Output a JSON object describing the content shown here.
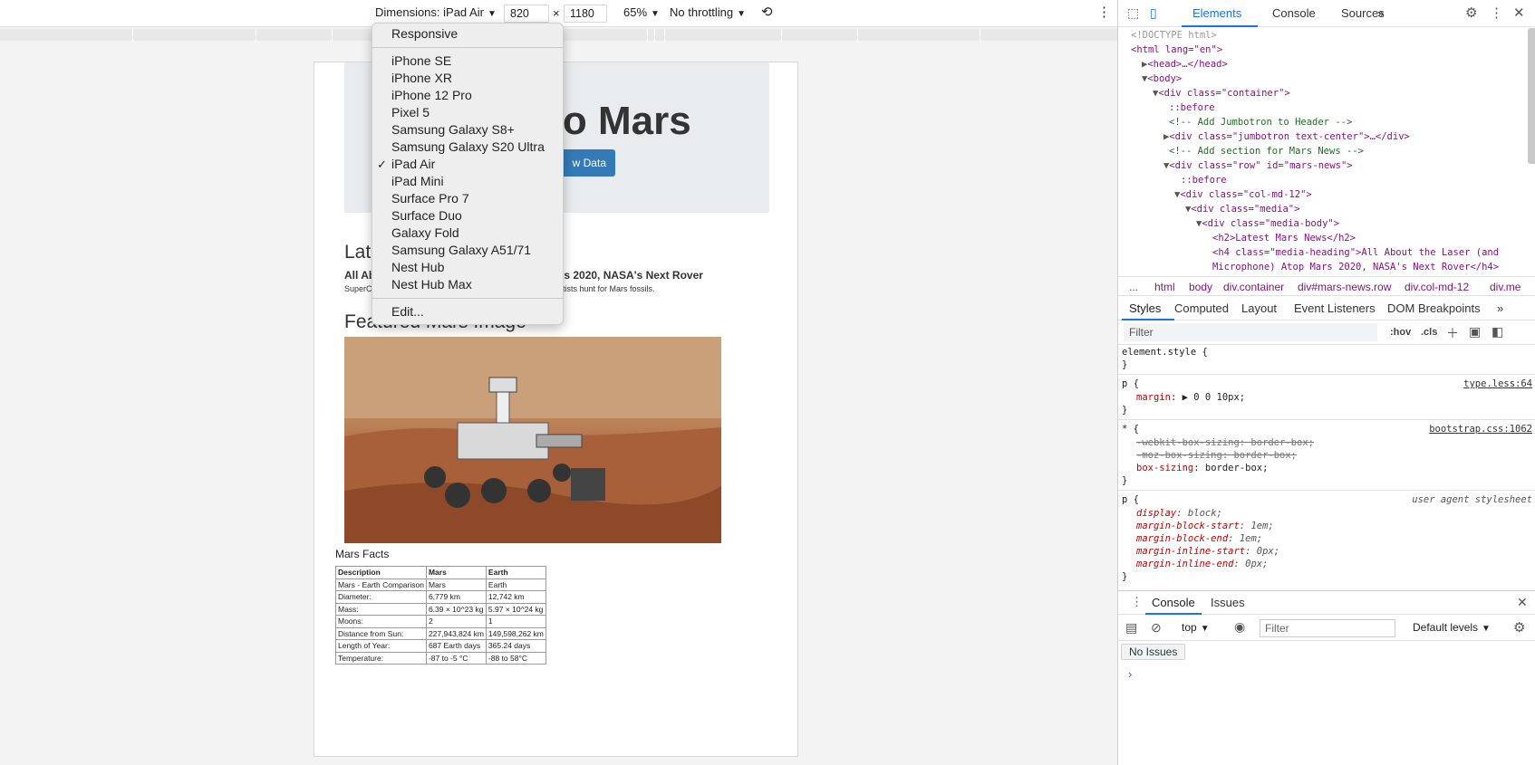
{
  "emulation_toolbar": {
    "dimensions_label": "Dimensions: iPad Air",
    "width_value": "820",
    "times": "×",
    "height_value": "1180",
    "zoom": "65%",
    "throttling": "No throttling"
  },
  "dimensions_menu": {
    "responsive": "Responsive",
    "devices": [
      "iPhone SE",
      "iPhone XR",
      "iPhone 12 Pro",
      "Pixel 5",
      "Samsung Galaxy S8+",
      "Samsung Galaxy S20 Ultra",
      "iPad Air",
      "iPad Mini",
      "Surface Pro 7",
      "Surface Duo",
      "Galaxy Fold",
      "Samsung Galaxy A51/71",
      "Nest Hub",
      "Nest Hub Max"
    ],
    "selected": "iPad Air",
    "check": "✓",
    "edit": "Edit..."
  },
  "page": {
    "jumbo_title": "to Mars",
    "jumbo_button": "w Data",
    "news_heading": "Late",
    "news_title_left": "All Ab",
    "news_title_right": "ars 2020, NASA's Next Rover",
    "news_teaser_left": "SuperC",
    "news_teaser_right": "entists hunt for Mars fossils.",
    "image_heading": "Featured Mars Image",
    "facts_title": "Mars Facts",
    "facts_headers": [
      "Description",
      "Mars",
      "Earth"
    ],
    "facts_rows": [
      [
        "Mars - Earth Comparison",
        "Mars",
        "Earth"
      ],
      [
        "Diameter:",
        "6,779 km",
        "12,742 km"
      ],
      [
        "Mass:",
        "6.39 × 10^23 kg",
        "5.97 × 10^24 kg"
      ],
      [
        "Moons:",
        "2",
        "1"
      ],
      [
        "Distance from Sun:",
        "227,943,824 km",
        "149,598,262 km"
      ],
      [
        "Length of Year:",
        "687 Earth days",
        "365.24 days"
      ],
      [
        "Temperature:",
        "-87 to -5 °C",
        "-88 to 58°C"
      ]
    ]
  },
  "devtools": {
    "tabs": [
      "Elements",
      "Console",
      "Sources"
    ],
    "more": "»",
    "dom": {
      "doctype": "<!DOCTYPE html>",
      "html": "<html lang=\"en\">",
      "head": "<head>…</head>",
      "body": "<body>",
      "container": "<div class=\"container\">",
      "before1": "::before",
      "cmt1": "<!-- Add Jumbotron to Header -->",
      "jumbo": "<div class=\"jumbotron text-center\">…</div>",
      "cmt2": "<!-- Add section for Mars News -->",
      "row": "<div class=\"row\" id=\"mars-news\">",
      "before2": "::before",
      "col": "<div class=\"col-md-12\">",
      "media": "<div class=\"media\">",
      "mediabody": "<div class=\"media-body\">",
      "h2": "<h2>Latest Mars News</h2>",
      "h4a": "<h4 class=\"media-heading\">All About the Laser (and",
      "h4b": "Microphone) Atop Mars 2020, NASA's Next Rover</h4>"
    },
    "breadcrumbs": [
      "...",
      "html",
      "body",
      "div.container",
      "div#mars-news.row",
      "div.col-md-12",
      "div.me"
    ],
    "styles_tabs": [
      "Styles",
      "Computed",
      "Layout",
      "Event Listeners",
      "DOM Breakpoints"
    ],
    "filter_placeholder": "Filter",
    "hov": ":hov",
    "cls": ".cls",
    "rules": {
      "element_style": "element.style {",
      "close": "}",
      "p_sel": "p {",
      "margin_prop": "margin",
      "margin_val": "▶ 0 0 10px;",
      "src1": "type.less:64",
      "star_sel": "* {",
      "src2": "bootstrap.css:1062",
      "webkit": "-webkit-box-sizing: border-box;",
      "moz": "-moz-box-sizing: border-box;",
      "boxsizing_prop": "box-sizing",
      "boxsizing_val": "border-box;",
      "ua_sel": "p {",
      "ua_src": "user agent stylesheet",
      "display_prop": "display",
      "display_val": "block;",
      "mbs_prop": "margin-block-start",
      "mbs_val": "1em;",
      "mbe_prop": "margin-block-end",
      "mbe_val": "1em;",
      "mis_prop": "margin-inline-start",
      "mis_val": "0px;",
      "mie_prop": "margin-inline-end",
      "mie_val": "0px;"
    },
    "console": {
      "tabs": [
        "Console",
        "Issues"
      ],
      "context": "top",
      "filter_placeholder": "Filter",
      "levels": "Default levels",
      "no_issues": "No Issues",
      "prompt": "›"
    }
  }
}
